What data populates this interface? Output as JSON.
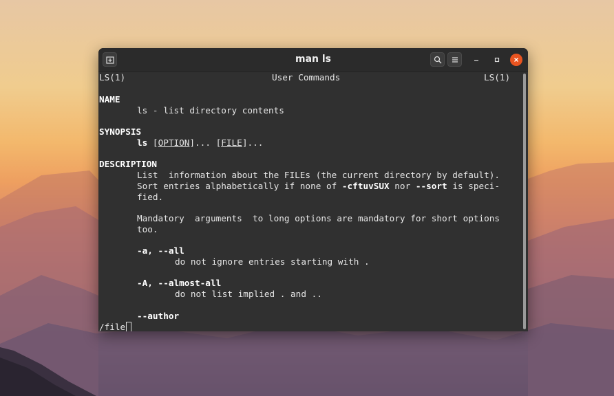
{
  "window": {
    "title": "man ls"
  },
  "header": {
    "left": "LS(1)",
    "center": "User Commands",
    "right": "LS(1)"
  },
  "name": {
    "heading": "NAME",
    "text": "ls - list directory contents"
  },
  "synopsis": {
    "heading": "SYNOPSIS",
    "cmd": "ls",
    "open1": "[",
    "opt": "OPTION",
    "mid": "]... [",
    "file": "FILE",
    "end": "]..."
  },
  "description": {
    "heading": "DESCRIPTION",
    "line1": "List  information about the FILEs (the current directory by default).",
    "line2_a": "Sort entries alphabetically if none of ",
    "line2_b": "-cftuvSUX",
    "line2_c": " nor ",
    "line2_d": "--sort",
    "line2_e": " is speci-",
    "line3": "fied.",
    "line4": "Mandatory  arguments  to long options are mandatory for short options",
    "line5": "too."
  },
  "options": [
    {
      "flag": "-a, --all",
      "desc": "do not ignore entries starting with ."
    },
    {
      "flag": "-A, --almost-all",
      "desc": "do not list implied . and .."
    },
    {
      "flag": "--author"
    }
  ],
  "prompt": {
    "text": "/file"
  },
  "icons": {
    "new_tab": "new-tab-icon",
    "search": "search-icon",
    "menu": "hamburger-menu-icon",
    "minimize": "minimize-icon",
    "maximize": "maximize-icon",
    "close": "close-icon"
  },
  "colors": {
    "close": "#e95420",
    "terminal_bg": "#303030"
  }
}
